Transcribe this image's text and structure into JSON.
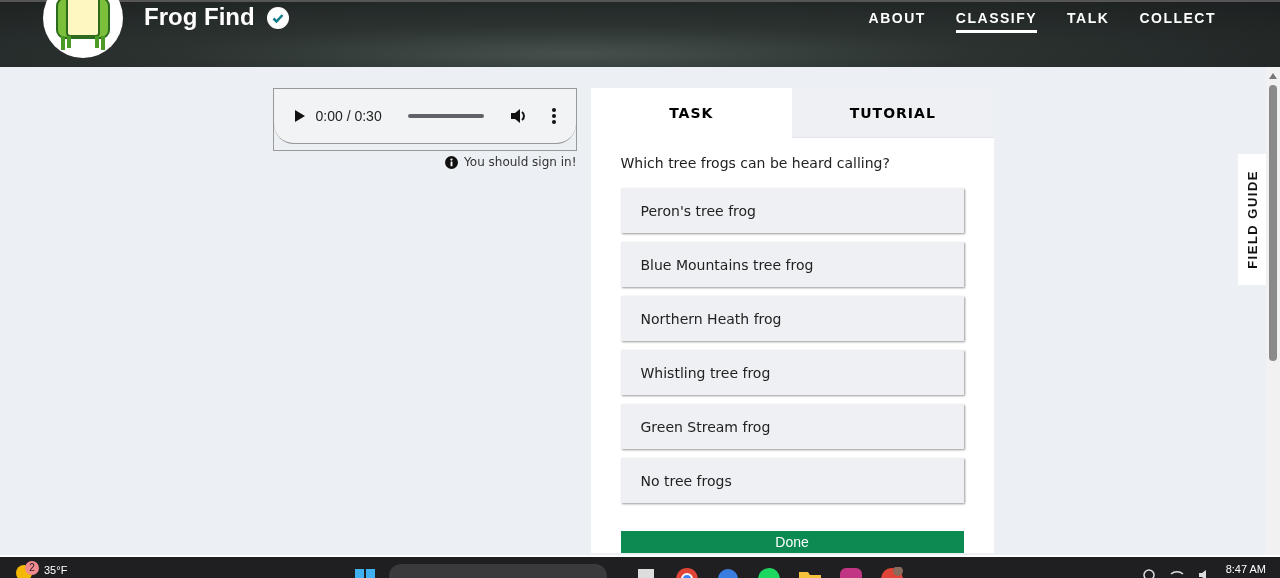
{
  "header": {
    "title": "Frog Find",
    "nav": [
      {
        "label": "ABOUT",
        "selected": false
      },
      {
        "label": "CLASSIFY",
        "selected": true
      },
      {
        "label": "TALK",
        "selected": false
      },
      {
        "label": "COLLECT",
        "selected": false
      }
    ]
  },
  "audio": {
    "time": "0:00 / 0:30",
    "notice": "You should sign in!"
  },
  "task_panel": {
    "tabs": [
      {
        "label": "TASK",
        "selected": true
      },
      {
        "label": "TUTORIAL",
        "selected": false
      }
    ],
    "question": "Which tree frogs can be heard calling?",
    "options": [
      {
        "label": "Peron's tree frog"
      },
      {
        "label": "Blue Mountains tree frog"
      },
      {
        "label": "Northern Heath frog"
      },
      {
        "label": "Whistling tree frog"
      },
      {
        "label": "Green Stream frog"
      },
      {
        "label": "No tree frogs"
      }
    ],
    "done_button": "Done"
  },
  "field_guide": "FIELD GUIDE",
  "taskbar": {
    "weather": {
      "badge": "2",
      "temperature": "35°F"
    },
    "time": "8:47 AM"
  }
}
